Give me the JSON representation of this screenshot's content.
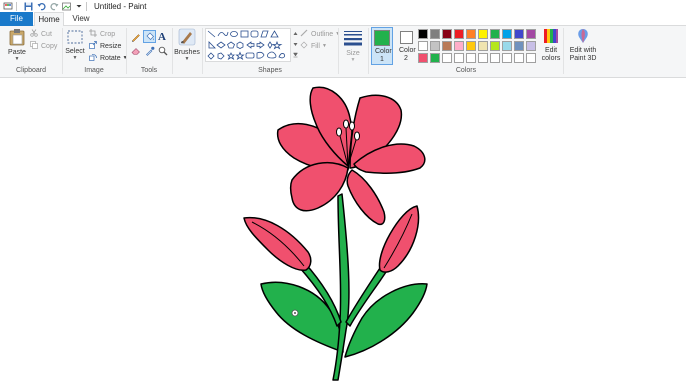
{
  "window": {
    "title": "Untitled - Paint"
  },
  "tabs": {
    "file": "File",
    "home": "Home",
    "view": "View"
  },
  "clipboard": {
    "paste": "Paste",
    "cut": "Cut",
    "copy": "Copy",
    "label": "Clipboard"
  },
  "image": {
    "select": "Select",
    "crop": "Crop",
    "resize": "Resize",
    "rotate": "Rotate",
    "label": "Image"
  },
  "tools": {
    "label": "Tools"
  },
  "brushes": {
    "label": "Brushes"
  },
  "shapes": {
    "outline": "Outline",
    "fill": "Fill",
    "label": "Shapes"
  },
  "size": {
    "label": "Size"
  },
  "colors": {
    "color1_label": "Color 1",
    "color2_label": "Color 2",
    "color1_value": "#22b14c",
    "color2_value": "#ffffff",
    "edit_colors": "Edit colors",
    "edit_with_paint3d": "Edit with Paint 3D",
    "label": "Colors",
    "palette_row1": [
      "#000000",
      "#7f7f7f",
      "#880015",
      "#ed1c24",
      "#ff7f27",
      "#fff200",
      "#22b14c",
      "#00a2e8",
      "#3f48cc",
      "#a349a4"
    ],
    "palette_row2": [
      "#ffffff",
      "#c3c3c3",
      "#b97a57",
      "#ffaec9",
      "#ffc90e",
      "#efe4b0",
      "#b5e61d",
      "#99d9ea",
      "#7092be",
      "#c8bfe7"
    ],
    "palette_row3": [
      "#f0506e",
      "#22b14c",
      "#ffffff",
      "#ffffff",
      "#ffffff",
      "#ffffff",
      "#ffffff",
      "#ffffff",
      "#ffffff",
      "#ffffff"
    ]
  },
  "drawing": {
    "petal_color": "#f0506e",
    "leaf_color": "#22b14c",
    "outline_color": "#000000"
  }
}
